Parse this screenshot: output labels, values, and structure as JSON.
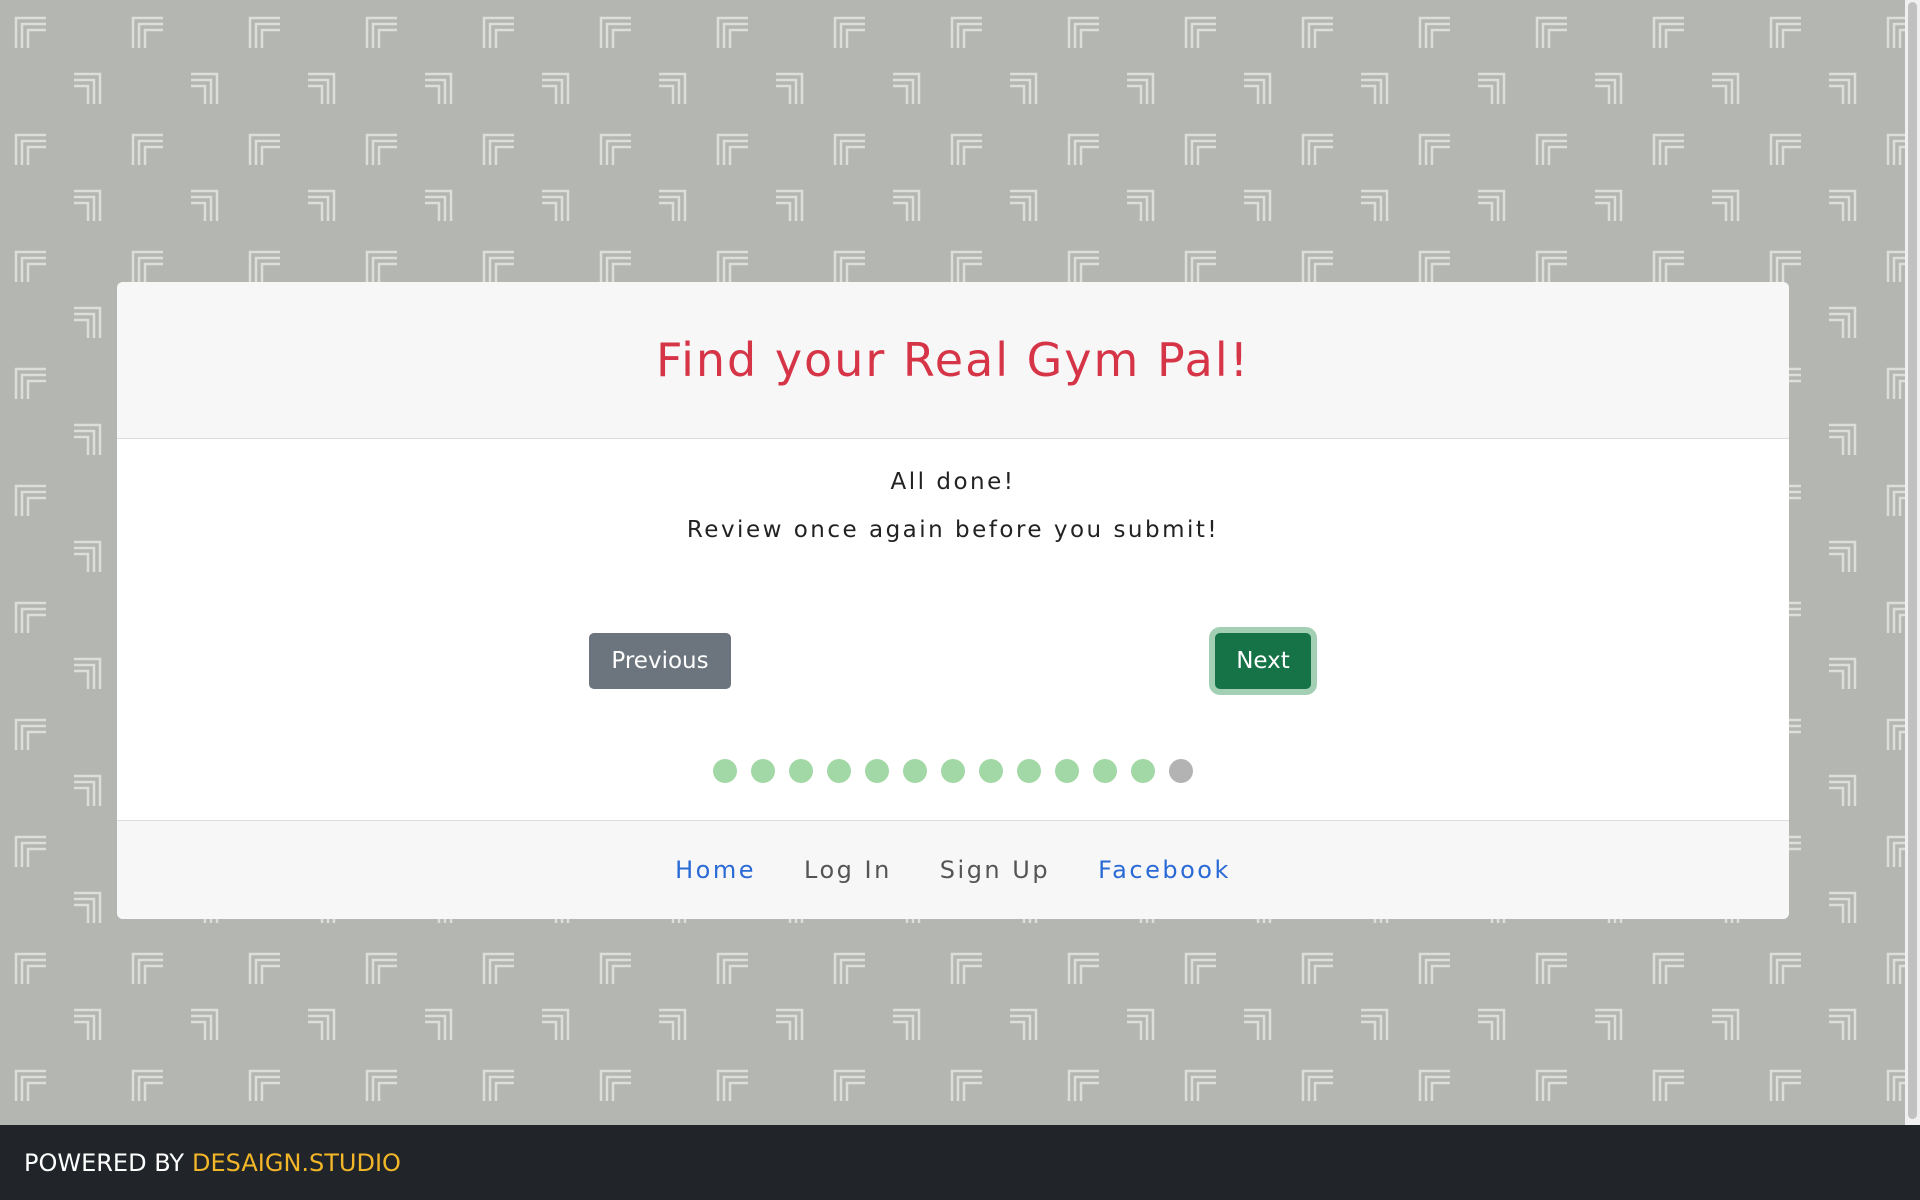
{
  "header": {
    "title": "Find your Real Gym Pal!"
  },
  "body": {
    "line1": "All done!",
    "line2": "Review once again before you submit!"
  },
  "buttons": {
    "previous": "Previous",
    "next": "Next"
  },
  "progress": {
    "total_steps": 13,
    "completed_steps": 12
  },
  "footer": {
    "links": [
      {
        "label": "Home"
      },
      {
        "label": "Log In"
      },
      {
        "label": "Sign Up"
      },
      {
        "label": "Facebook"
      }
    ]
  },
  "bottom_bar": {
    "prefix": "POWERED BY",
    "brand": "DESAIGN.STUDIO"
  },
  "colors": {
    "title": "#d63447",
    "next_button": "#167347",
    "previous_button": "#6c757d",
    "dot_complete": "#a2d8a5",
    "dot_pending": "#b3b3b3",
    "link_blue": "#2a6ad6",
    "brand_yellow": "#f2b628",
    "bottom_bar": "#212529"
  }
}
